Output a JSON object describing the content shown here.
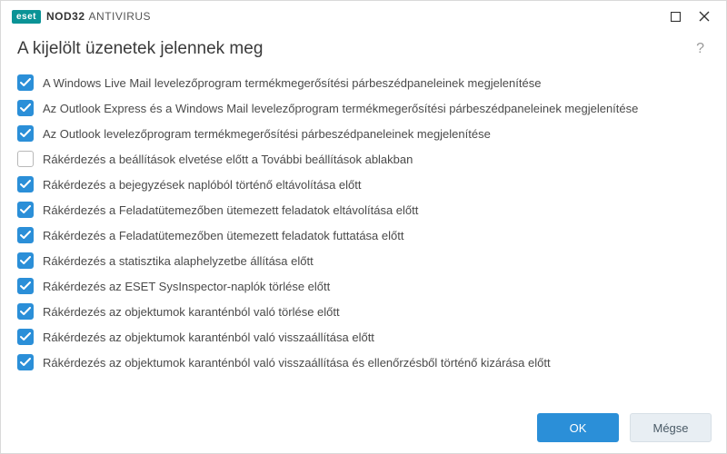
{
  "titlebar": {
    "brand_badge": "eset",
    "brand_bold": "NOD32",
    "brand_rest": "ANTIVIRUS"
  },
  "heading": "A kijelölt üzenetek jelennek meg",
  "help_symbol": "?",
  "options": [
    {
      "checked": true,
      "label": "A Windows Live Mail levelezőprogram termékmegerősítési párbeszédpaneleinek megjelenítése"
    },
    {
      "checked": true,
      "label": "Az Outlook Express és a Windows Mail levelezőprogram termékmegerősítési párbeszédpaneleinek megjelenítése"
    },
    {
      "checked": true,
      "label": "Az Outlook levelezőprogram termékmegerősítési párbeszédpaneleinek megjelenítése"
    },
    {
      "checked": false,
      "label": "Rákérdezés a beállítások elvetése előtt a További beállítások ablakban"
    },
    {
      "checked": true,
      "label": "Rákérdezés a bejegyzések naplóból történő eltávolítása előtt"
    },
    {
      "checked": true,
      "label": "Rákérdezés a Feladatütemezőben ütemezett feladatok eltávolítása előtt"
    },
    {
      "checked": true,
      "label": "Rákérdezés a Feladatütemezőben ütemezett feladatok futtatása előtt"
    },
    {
      "checked": true,
      "label": "Rákérdezés a statisztika alaphelyzetbe állítása előtt"
    },
    {
      "checked": true,
      "label": "Rákérdezés az ESET SysInspector-naplók törlése előtt"
    },
    {
      "checked": true,
      "label": "Rákérdezés az objektumok karanténból való törlése előtt"
    },
    {
      "checked": true,
      "label": "Rákérdezés az objektumok karanténból való visszaállítása előtt"
    },
    {
      "checked": true,
      "label": "Rákérdezés az objektumok karanténból való visszaállítása és ellenőrzésből történő kizárása előtt"
    }
  ],
  "footer": {
    "ok_label": "OK",
    "cancel_label": "Mégse"
  }
}
